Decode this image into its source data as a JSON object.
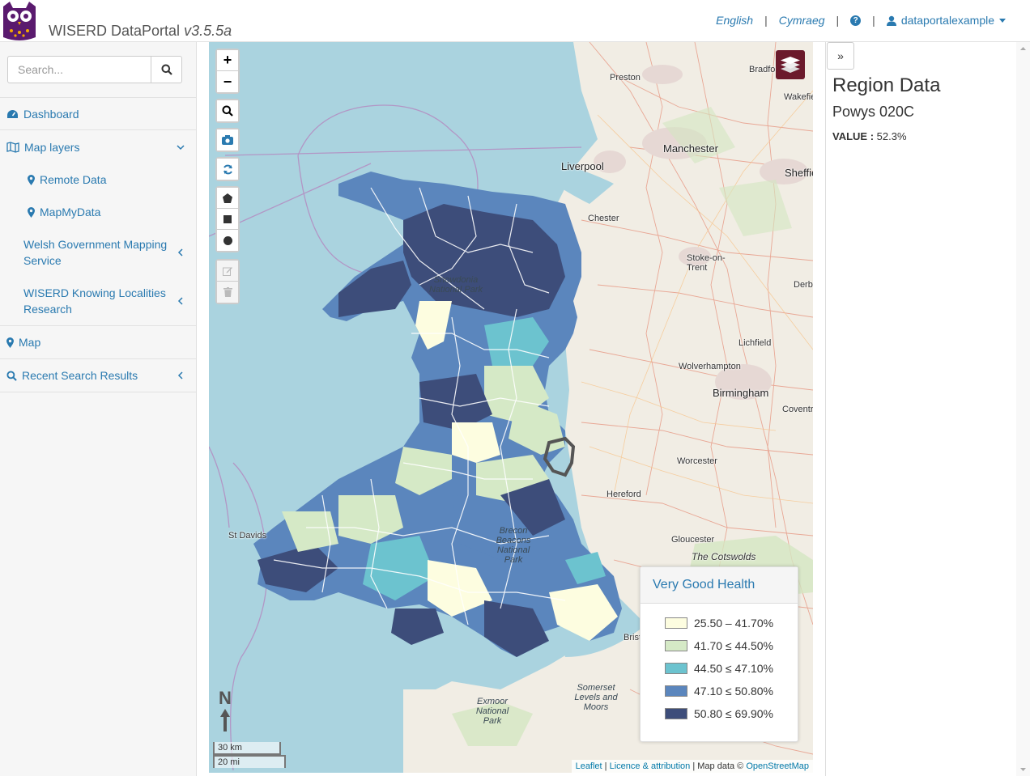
{
  "header": {
    "app_name": "WISERD DataPortal",
    "version": "v3.5.5a",
    "lang_en": "English",
    "lang_cy": "Cymraeg",
    "separator": "|",
    "username": "dataportalexample"
  },
  "sidebar": {
    "search_placeholder": "Search...",
    "items": [
      {
        "label": "Dashboard",
        "icon": "dashboard-icon"
      },
      {
        "label": "Map layers",
        "icon": "map-icon"
      },
      {
        "label": "Remote Data",
        "icon": "map-marker-icon"
      },
      {
        "label": "MapMyData",
        "icon": "map-marker-icon"
      },
      {
        "label": "Welsh Government Mapping Service"
      },
      {
        "label": "WISERD Knowing Localities Research"
      },
      {
        "label": "Map",
        "icon": "map-marker-icon"
      },
      {
        "label": "Recent Search Results",
        "icon": "search-icon"
      }
    ]
  },
  "map": {
    "cities": [
      "Preston",
      "Bradford",
      "Wakefield",
      "Manchester",
      "Liverpool",
      "Sheffield",
      "Chester",
      "Stoke-on-Trent",
      "Derby",
      "Lichfield",
      "Wolverhampton",
      "Birmingham",
      "Coventry",
      "Worcester",
      "Hereford",
      "Gloucester",
      "The Cotswolds",
      "Bristol",
      "Somerset Levels and Moors",
      "Exmoor National Park",
      "St Davids",
      "Snowdonia National Park",
      "Brecon Beacons National Park"
    ],
    "legend": {
      "title": "Very Good Health",
      "classes": [
        {
          "label": "25.50 – 41.70%",
          "color": "#fdfde0"
        },
        {
          "label": "41.70 ≤ 44.50%",
          "color": "#d5e9c6"
        },
        {
          "label": "44.50 ≤ 47.10%",
          "color": "#6cc3cf"
        },
        {
          "label": "47.10 ≤ 50.80%",
          "color": "#5b86bd"
        },
        {
          "label": "50.80 ≤ 69.90%",
          "color": "#3d4d7a"
        }
      ]
    },
    "scale": {
      "km": "30 km",
      "mi": "20 mi"
    },
    "north_label": "N",
    "attribution": {
      "leaflet": "Leaflet",
      "licence": "Licence & attribution",
      "mapdata": "Map data ©",
      "osm": "OpenStreetMap"
    }
  },
  "panel": {
    "collapse_label": "»",
    "title": "Region Data",
    "region": "Powys 020C",
    "value_label": "VALUE :",
    "value": "52.3%"
  }
}
